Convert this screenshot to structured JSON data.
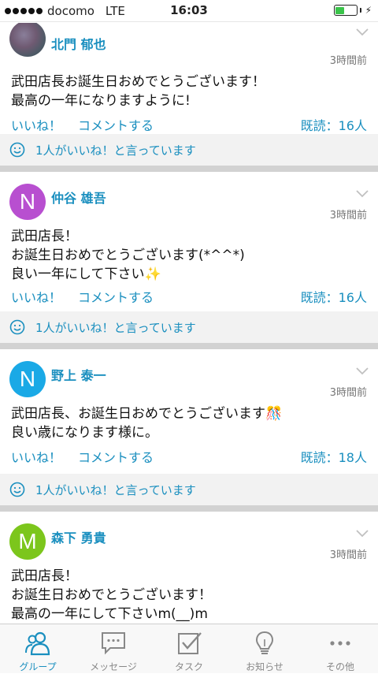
{
  "status_bar": {
    "carrier": "docomo",
    "network": "LTE",
    "time": "16:03",
    "battery_level": 0.45
  },
  "posts": [
    {
      "author": "北門 郁也",
      "avatar_letter": "",
      "avatar_color": "#6f5a72",
      "time": "3時間前",
      "body": "武田店長お誕生日おめでとうございます！\n最高の一年になりますように!",
      "like_label": "いいね！",
      "comment_label": "コメントする",
      "read": "既読：16人",
      "likes_text": "1人がいいね！と言っています"
    },
    {
      "author": "仲谷 雄吾",
      "avatar_letter": "N",
      "avatar_color": "#b84fd0",
      "time": "3時間前",
      "body": "武田店長！\nお誕生日おめでとうございます(*^^*)\n良い一年にして下さい✨",
      "like_label": "いいね！",
      "comment_label": "コメントする",
      "read": "既読：16人",
      "likes_text": "1人がいいね！と言っています"
    },
    {
      "author": "野上 泰一",
      "avatar_letter": "N",
      "avatar_color": "#1aa9e6",
      "time": "3時間前",
      "body": "武田店長、お誕生日おめでとうございます🎊\n良い歳になります様に。",
      "like_label": "いいね！",
      "comment_label": "コメントする",
      "read": "既読：18人",
      "likes_text": "1人がいいね！と言っています"
    },
    {
      "author": "森下 勇貴",
      "avatar_letter": "M",
      "avatar_color": "#7cc61c",
      "time": "3時間前",
      "body": "武田店長！\nお誕生日おめでとうございます！\n最高の一年にして下さいm(__)m",
      "like_label": "",
      "comment_label": "",
      "read": "",
      "likes_text": ""
    }
  ],
  "tabs": [
    {
      "label": "グループ",
      "icon": "group-icon",
      "active": true
    },
    {
      "label": "メッセージ",
      "icon": "message-icon",
      "active": false
    },
    {
      "label": "タスク",
      "icon": "task-icon",
      "active": false
    },
    {
      "label": "お知らせ",
      "icon": "notification-icon",
      "active": false
    },
    {
      "label": "その他",
      "icon": "more-icon",
      "active": false
    }
  ],
  "colors": {
    "accent": "#1a8fbf",
    "like_bar": "#f2f2f2",
    "separator": "#d2d2d2"
  }
}
